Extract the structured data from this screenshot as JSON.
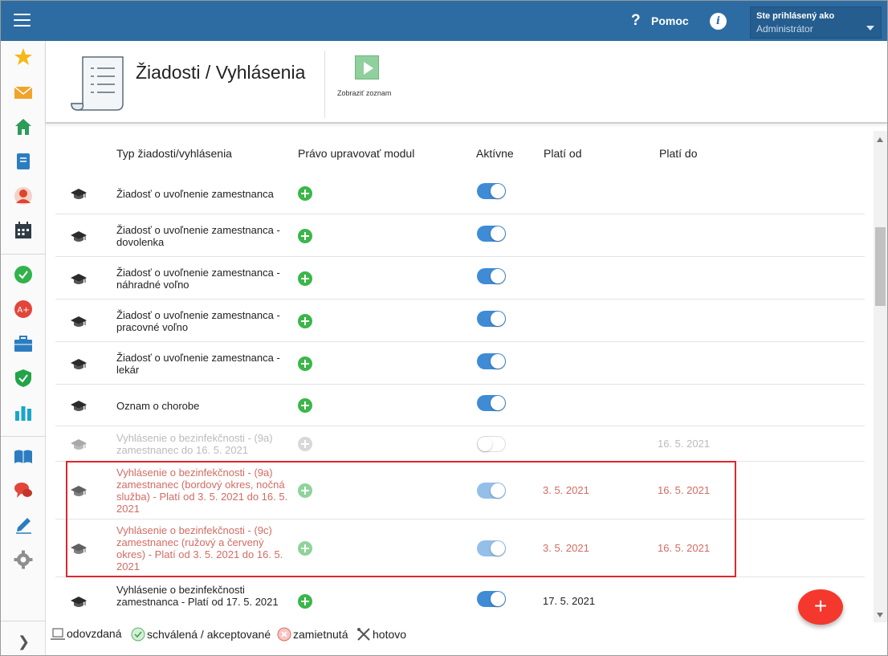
{
  "header": {
    "help_label": "Pomoc",
    "user_line1": "Ste prihlásený ako",
    "user_line2": "Administrátor"
  },
  "page": {
    "title": "Žiadosti / Vyhlásenia",
    "show_list_label": "Zobraziť zoznam"
  },
  "table": {
    "columns": {
      "type": "Typ žiadosti/vyhlásenia",
      "edit_right": "Právo upravovať modul",
      "active": "Aktívne",
      "valid_from": "Platí od",
      "valid_to": "Platí do"
    },
    "rows": [
      {
        "name": "Žiadosť o uvoľnenie zamestnanca",
        "active": true,
        "valid_from": "",
        "valid_to": "",
        "state": "normal"
      },
      {
        "name": "Žiadosť o uvoľnenie zamestnanca - dovolenka",
        "active": true,
        "valid_from": "",
        "valid_to": "",
        "state": "normal"
      },
      {
        "name": "Žiadosť o uvoľnenie zamestnanca - náhradné voľno",
        "active": true,
        "valid_from": "",
        "valid_to": "",
        "state": "normal"
      },
      {
        "name": "Žiadosť o uvoľnenie zamestnanca - pracovné voľno",
        "active": true,
        "valid_from": "",
        "valid_to": "",
        "state": "normal"
      },
      {
        "name": "Žiadosť o uvoľnenie zamestnanca - lekár",
        "active": true,
        "valid_from": "",
        "valid_to": "",
        "state": "normal"
      },
      {
        "name": "Oznam o chorobe",
        "active": true,
        "valid_from": "",
        "valid_to": "",
        "state": "normal"
      },
      {
        "name": "Vyhlásenie o bezinfekčnosti - (9a) zamestnanec do 16. 5. 2021",
        "active": false,
        "valid_from": "",
        "valid_to": "16. 5. 2021",
        "state": "disabled"
      },
      {
        "name": "Vyhlásenie o bezinfekčnosti - (9a) zamestnanec (bordový okres, nočná služba) - Platí od 3. 5. 2021 do 16. 5. 2021",
        "active": true,
        "valid_from": "3. 5. 2021",
        "valid_to": "16. 5. 2021",
        "state": "red"
      },
      {
        "name": "Vyhlásenie o bezinfekčnosti - (9c) zamestnanec (ružový a červený okres) - Platí od 3. 5. 2021 do 16. 5. 2021",
        "active": true,
        "valid_from": "3. 5. 2021",
        "valid_to": "16. 5. 2021",
        "state": "red"
      },
      {
        "name": "Vyhlásenie o bezinfekčnosti zamestnanca - Platí od 17. 5. 2021",
        "active": true,
        "valid_from": "17. 5. 2021",
        "valid_to": "",
        "state": "normal"
      }
    ]
  },
  "legend": {
    "submitted": "odovzdaná",
    "approved": "schválená / akceptované",
    "rejected": "zamietnutá",
    "done": "hotovo"
  },
  "fab_label": "+",
  "colors": {
    "topbar": "#2d6ca2",
    "accent_green": "#3cb64a",
    "toggle_on": "#3f8bd6",
    "highlight": "#e0252f",
    "fab": "#f4382d"
  }
}
